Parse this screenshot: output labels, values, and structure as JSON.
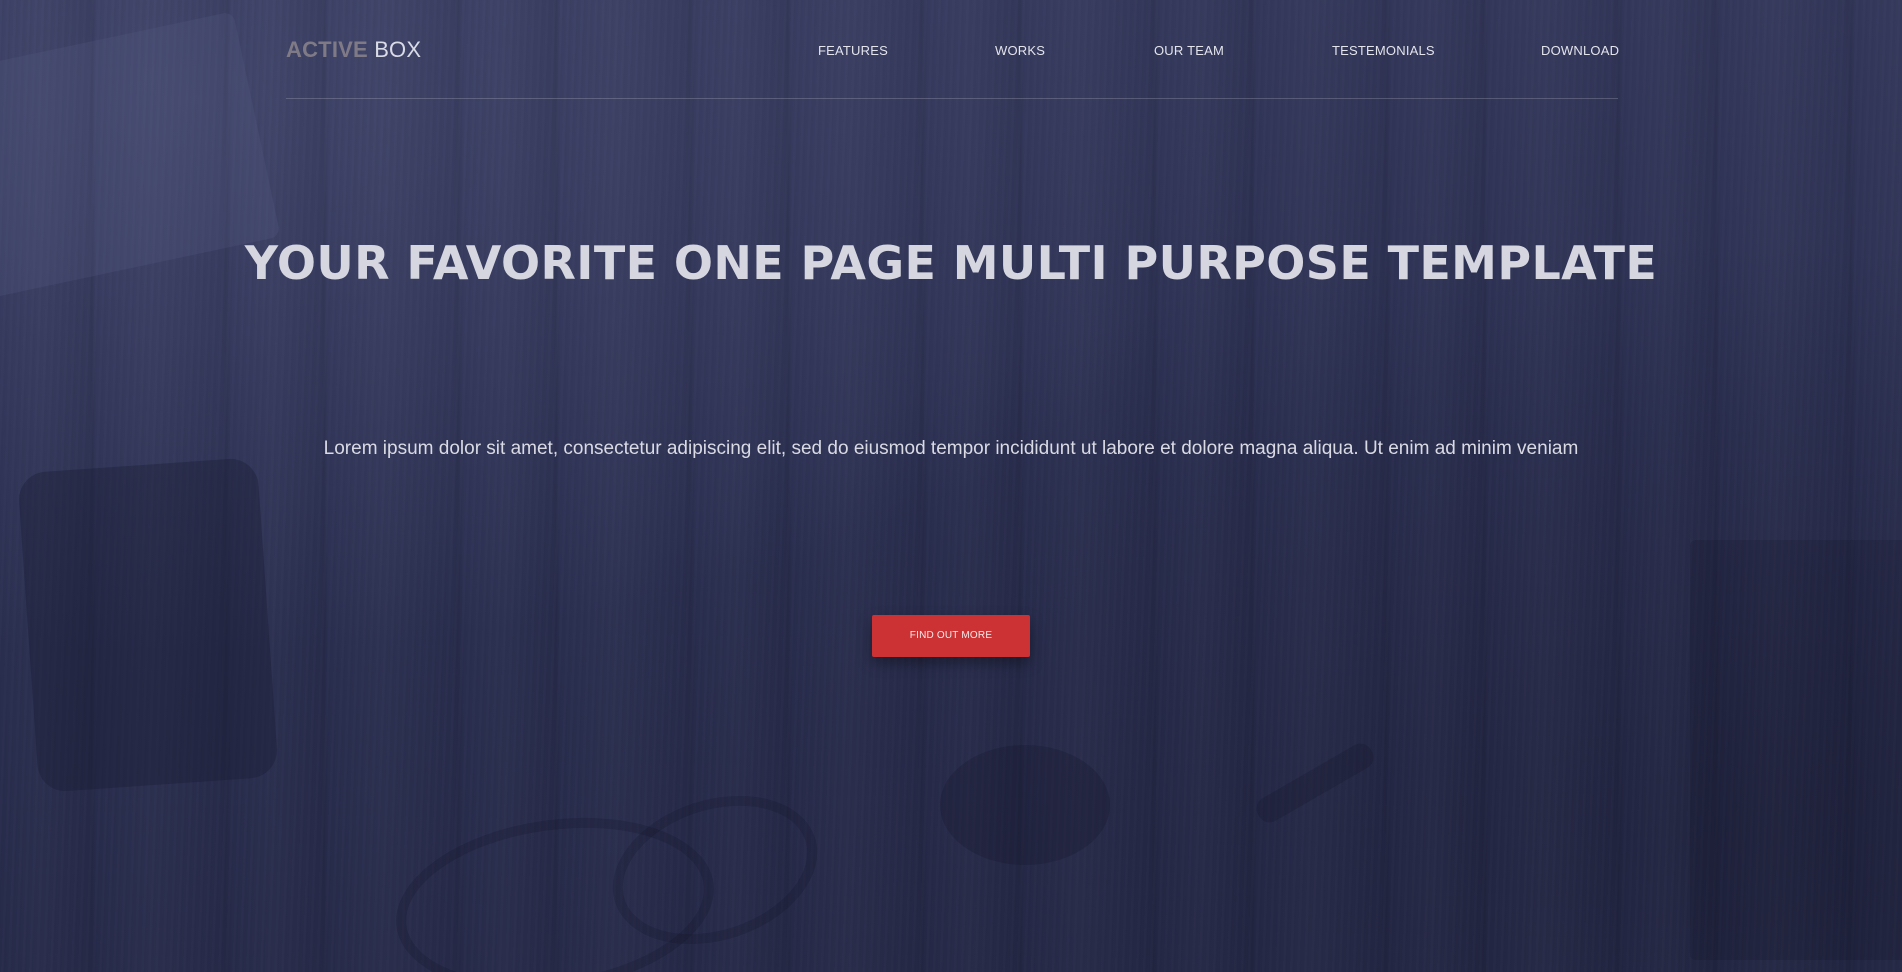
{
  "logo": {
    "part1": "ACTIVE",
    "part2": "BOX"
  },
  "nav": {
    "items": [
      {
        "label": "FEATURES"
      },
      {
        "label": "WORKS"
      },
      {
        "label": "OUR TEAM"
      },
      {
        "label": "TESTEMONIALS"
      },
      {
        "label": "DOWNLOAD"
      }
    ]
  },
  "hero": {
    "headline": "YOUR FAVORITE ONE PAGE MULTI PURPOSE TEMPLATE",
    "subtext": "Lorem ipsum dolor sit amet, consectetur adipiscing elit, sed do eiusmod tempor incididunt ut labore et dolore magna aliqua. Ut enim ad minim veniam",
    "cta_label": "FIND OUT MORE"
  },
  "colors": {
    "background": "#2b2f4e",
    "accent": "#cc3234",
    "logo_muted": "#7f7a86",
    "text_light": "#d5d6e0"
  }
}
